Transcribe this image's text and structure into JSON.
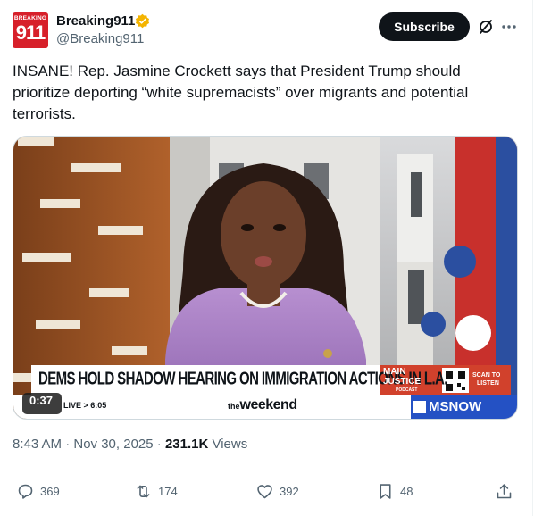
{
  "account": {
    "avatar_small_text": "BREAKING",
    "avatar_big_text": "911",
    "display_name": "Breaking911",
    "handle": "@Breaking911",
    "verified_color": "#f4b400"
  },
  "header": {
    "subscribe_label": "Subscribe"
  },
  "tweet": {
    "text": "INSANE! Rep. Jasmine Crockett says that President Trump should prioritize deporting “white supremacists” over migrants and potential terrorists."
  },
  "video": {
    "duration": "0:37",
    "chyron": "DEMS HOLD SHADOW HEARING ON IMMIGRATION ACTIONS IN L.A.",
    "live_label": "LIVE",
    "live_time": "6:05",
    "show_logo": "weekend",
    "show_logo_prefix": "the",
    "podcast_title_1": "MAIN",
    "podcast_title_2": "JUSTICE",
    "podcast_sub": "PODCAST",
    "scan_label_1": "SCAN TO",
    "scan_label_2": "LISTEN",
    "network": "MSNOW"
  },
  "meta": {
    "time": "8:43 AM · Nov 30, 2025 · ",
    "views_count": "231.1K",
    "views_label": " Views"
  },
  "actions": {
    "replies": "369",
    "reposts": "174",
    "likes": "392",
    "bookmarks": "48"
  },
  "icons": [
    "verified-badge-icon",
    "grok-icon",
    "more-icon",
    "reply-icon",
    "repost-icon",
    "like-icon",
    "bookmark-icon",
    "share-icon"
  ]
}
